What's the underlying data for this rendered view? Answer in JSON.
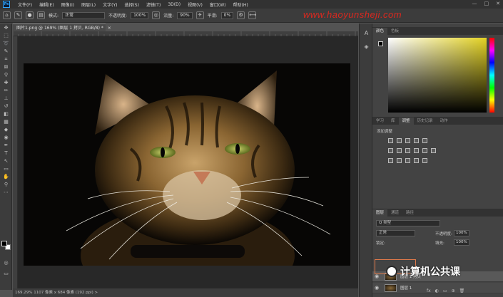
{
  "menu": {
    "logo": "Ps",
    "items": [
      "文件(F)",
      "编辑(E)",
      "图像(I)",
      "图层(L)",
      "文字(Y)",
      "选择(S)",
      "滤镜(T)",
      "3D(D)",
      "视图(V)",
      "窗口(W)",
      "帮助(H)"
    ],
    "controls": [
      "—",
      "□",
      "✕"
    ]
  },
  "options": {
    "mode_label": "模式:",
    "mode_value": "正常",
    "opacity_label": "不透明度:",
    "opacity_value": "100%",
    "flow_label": "流量:",
    "flow_value": "90%",
    "smooth_label": "平滑:",
    "smooth_value": "0%",
    "watermark": "www.haoyunsheji.com"
  },
  "document": {
    "tab_label": "图片1.png @ 169% (图层 1 拷贝, RGB/8) *",
    "tab_close": "×",
    "status": "169.29%   1107 像素 x 684 像素 (192 ppi)   >"
  },
  "color_panel": {
    "tabs": [
      "颜色",
      "色板"
    ],
    "foreground": "#000000",
    "background": "#ffffff",
    "field_color": "#e3d223"
  },
  "adjustments_panel": {
    "tabs": [
      "学习",
      "库",
      "调整",
      "历史记录",
      "动作"
    ],
    "active_tab": 2,
    "title": "添加调整"
  },
  "layers_panel": {
    "tabs": [
      "图层",
      "通道",
      "路径"
    ],
    "filter_label": "Q 类型",
    "blend_mode": "正常",
    "opacity_label": "不透明度:",
    "opacity_value": "100%",
    "lock_label": "锁定:",
    "fill_label": "填充:",
    "fill_value": "100%",
    "layers": [
      {
        "name": "图层 1 拷贝",
        "visible": true
      },
      {
        "name": "图层 1",
        "visible": true
      }
    ]
  },
  "overlay_watermark": "计算机公共课",
  "footer_icons": [
    "fx",
    "◐",
    "▭",
    "⊕",
    "🗑"
  ]
}
